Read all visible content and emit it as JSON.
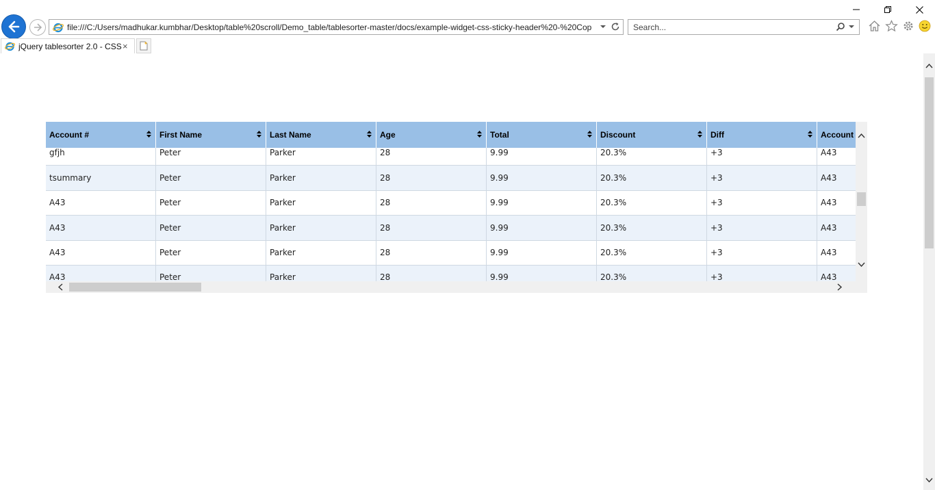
{
  "browser": {
    "address": "file:///C:/Users/madhukar.kumbhar/Desktop/table%20scroll/Demo_table/tablesorter-master/docs/example-widget-css-sticky-header%20-%20Cop",
    "search_placeholder": "Search...",
    "tab_title": "jQuery tablesorter 2.0 - CSS ...",
    "tab_close": "×",
    "accent_color": "#1e73d3"
  },
  "table": {
    "header_color": "#99bfe6",
    "columns": [
      "Account #",
      "First Name",
      "Last Name",
      "Age",
      "Total",
      "Discount",
      "Diff",
      "Account #"
    ],
    "rows": [
      [
        "gfjh",
        "Peter",
        "Parker",
        "28",
        "9.99",
        "20.3%",
        "+3",
        "A43"
      ],
      [
        "tsummary",
        "Peter",
        "Parker",
        "28",
        "9.99",
        "20.3%",
        "+3",
        "A43"
      ],
      [
        "A43",
        "Peter",
        "Parker",
        "28",
        "9.99",
        "20.3%",
        "+3",
        "A43"
      ],
      [
        "A43",
        "Peter",
        "Parker",
        "28",
        "9.99",
        "20.3%",
        "+3",
        "A43"
      ],
      [
        "A43",
        "Peter",
        "Parker",
        "28",
        "9.99",
        "20.3%",
        "+3",
        "A43"
      ],
      [
        "A43",
        "Peter",
        "Parker",
        "28",
        "9.99",
        "20.3%",
        "+3",
        "A43"
      ]
    ]
  }
}
